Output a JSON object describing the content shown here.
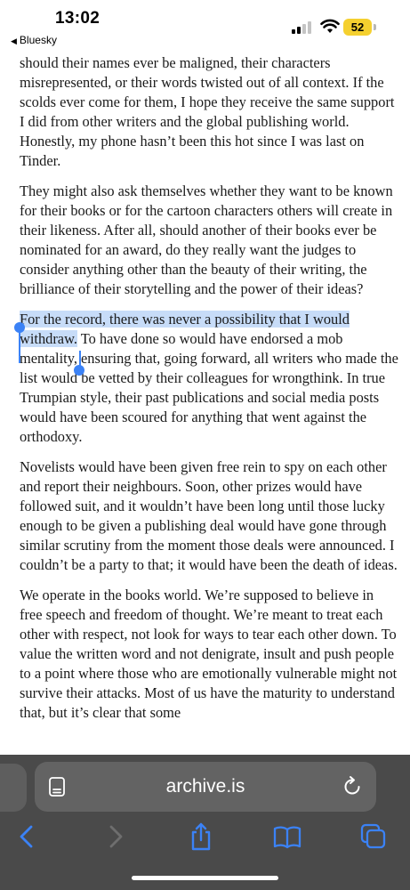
{
  "status_bar": {
    "time": "13:02",
    "back_app": "Bluesky",
    "battery": "52",
    "battery_color": "#f5d02f"
  },
  "article": {
    "paragraphs": [
      "should their names ever be maligned, their characters misrepresented, or their words twisted out of all context. If the scolds ever come for them, I hope they receive the same support I did from other writers and the global publishing world. Honestly, my phone hasn’t been this hot since I was last on Tinder.",
      "They might also ask themselves whether they want to be known for their books or for the cartoon characters others will create in their likeness. After all, should another of their books ever be nominated for an award, do they really want the judges to consider anything other than the beauty of their writing, the brilliance of their storytelling and the power of their ideas?",
      "Novelists would have been given free rein to spy on each other and report their neighbours. Soon, other prizes would have followed suit, and it wouldn’t have been long until those lucky enough to be given a publishing deal would have gone through similar scrutiny from the moment those deals were announced. I couldn’t be a party to that; it would have been the death of ideas.",
      "We operate in the books world. We’re supposed to believe in free speech and freedom of thought. We’re meant to treat each other with respect, not look for ways to tear each other down. To value the written word and not denigrate, insult and push people to a point where those who are emotionally vulnerable might not survive their attacks. Most of us have the maturity to understand that, but it’s clear that some"
    ],
    "selected_text": "For the record, there was never a possibility that I would withdraw.",
    "after_selection": " To have done so would have endorsed a mob mentality, ensuring that, going forward, all writers who made the list would be vetted by their colleagues for wrongthink. In true Trumpian style, their past publications and social media posts would have been scoured for anything that went against the orthodoxy.",
    "selection_color": "#c7dcf8",
    "handle_color": "#3b82f6"
  },
  "toolbar": {
    "url": "archive.is",
    "icons": [
      "reader-icon",
      "reload-icon",
      "back-icon",
      "forward-icon",
      "share-icon",
      "bookmarks-icon",
      "tabs-icon"
    ],
    "accent": "#3b82f6"
  }
}
